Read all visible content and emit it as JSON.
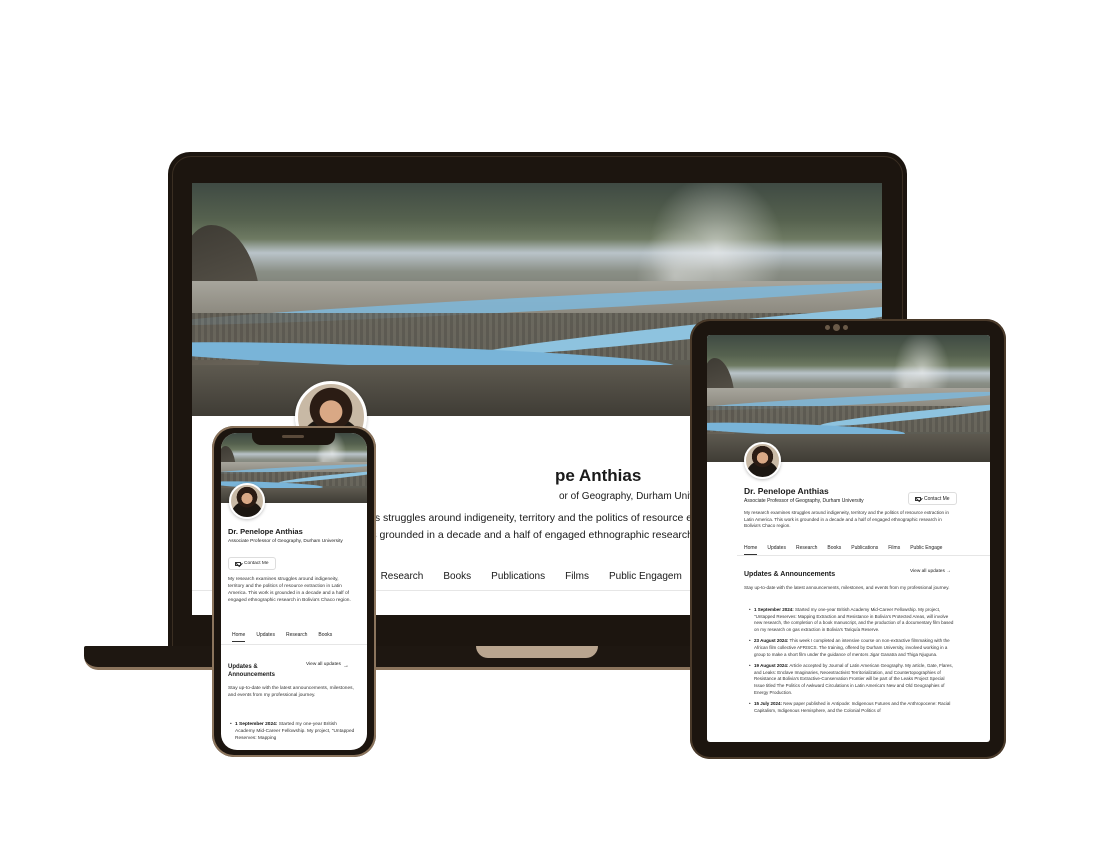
{
  "profile": {
    "name": "Dr. Penelope Anthias",
    "title": "Associate Professor of Geography, Durham University",
    "contact_label": "Contact Me",
    "bio": "My research examines struggles around indigeneity, territory and the politics of resource extraction in Latin America. This work is grounded in a decade and a half of engaged ethnographic research in Bolivia's Chaco region."
  },
  "laptop": {
    "name_visible": "pe Anthias",
    "title_visible": "or of Geography, Durham University",
    "bio_line1": "es struggles around indigeneity, territory and the politics of resource extra",
    "bio_line2": "is grounded in a decade and a half of engaged ethnographic research in B",
    "tabs": [
      "es",
      "Research",
      "Books",
      "Publications",
      "Films",
      "Public Engagem"
    ]
  },
  "tablet": {
    "tabs": [
      "Home",
      "Updates",
      "Research",
      "Books",
      "Publications",
      "Films",
      "Public Engage"
    ],
    "section_title": "Updates & Announcements",
    "view_all": "View all updates →",
    "section_intro": "Stay up-to-date with the latest announcements, milestones, and events from my professional journey.",
    "news": [
      {
        "date": "1 September 2024:",
        "text": " Started my one-year British Academy Mid-Career Fellowship. My project, \"Untapped Reserves: Mapping Extraction and Resistance in Bolivia's Protected Areas, will involve new research, the completion of a book manuscript, and the production of a documentary film based on my research on gas extraction in Bolivia's Tariquía Reserve."
      },
      {
        "date": "23 August 2024:",
        "text": " This week I completed an intensive course on non-extractive filmmaking with the African film collective AFRISCS. The training, offered by Durham University, involved working in a group to make a short film under the guidance of mentors Jigar Ganatra and Thiga Njuguna."
      },
      {
        "date": "19 August 2024:",
        "text": " Article accepted by Journal of Latin American Geography. My article, Gate, Flares, and Leaks: Enclave Imaginaries, Neoextractivist Territorialization, and Countertopographies of Resistance at Bolivia's Extractive-Conservation Frontier will be part of the Leaks Project Special Issue titled The Politics of Awkward Circulations in Latin America's New and Old Geographies of Energy Production."
      },
      {
        "date": "15 July 2024:",
        "text": " New paper published in Antipode: Indigenous Futures and the Anthropocene: Racial Capitalism, Indigenous Hemisphere, and the Colonial Politics of"
      }
    ]
  },
  "phone": {
    "tabs": [
      "Home",
      "Updates",
      "Research",
      "Books"
    ],
    "section_title": "Updates & Announcements",
    "view_all": "View all updates",
    "view_all_arrow": "→",
    "news_date": "1 September 2024:",
    "news_text": " Started my one-year British Academy Mid-Career Fellowship. My project, \"Untapped Reserves: Mapping"
  }
}
